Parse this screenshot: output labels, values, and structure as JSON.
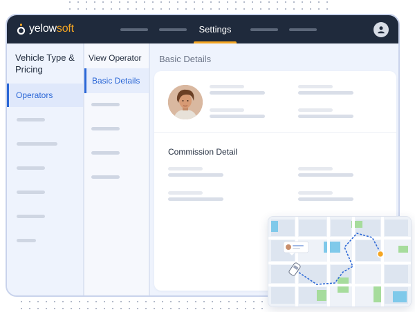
{
  "app": {
    "logo_prefix": "yelow",
    "logo_suffix": "soft",
    "active_nav": "Settings",
    "colors": {
      "topbar": "#1f2a3c",
      "accent": "#f5a623",
      "primary": "#2b67d6"
    }
  },
  "sidebar": {
    "title": "Vehicle Type & Pricing",
    "active_item": "Operators"
  },
  "subnav": {
    "title": "View Operator",
    "active_item": "Basic Details"
  },
  "main": {
    "title": "Basic Details",
    "section_title": "Commission Detail"
  },
  "icons": {
    "user": "user-icon",
    "logo": "yelowsoft-logo-icon",
    "map": "map-route-icon"
  }
}
